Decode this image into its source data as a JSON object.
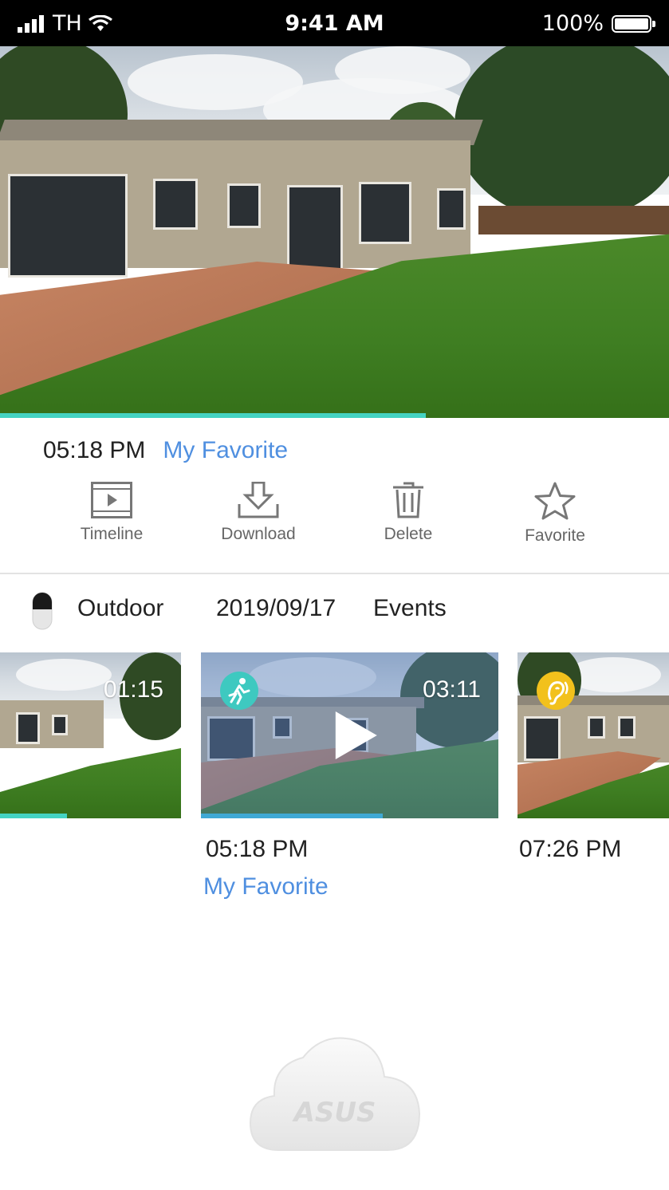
{
  "status_bar": {
    "carrier": "TH",
    "time": "9:41 AM",
    "battery": "100%"
  },
  "player": {
    "progress": 0.64,
    "time": "05:18 PM",
    "label": "My Favorite"
  },
  "actions": [
    {
      "label": "Timeline",
      "icon": "film-icon"
    },
    {
      "label": "Download",
      "icon": "download-icon"
    },
    {
      "label": "Delete",
      "icon": "trash-icon"
    },
    {
      "label": "Favorite",
      "icon": "star-icon"
    }
  ],
  "camera": {
    "name": "Outdoor",
    "date": "2019/09/17",
    "events_label": "Events"
  },
  "clips": [
    {
      "duration": "01:15",
      "progress": 0.37
    },
    {
      "duration": "03:11",
      "time": "05:18 PM",
      "label": "My Favorite",
      "event": "motion-icon",
      "progress": 0.61
    },
    {
      "time": "07:26 PM",
      "event": "sound-icon"
    }
  ],
  "colors": {
    "accent_teal": "#44d3c2",
    "link_blue": "#4f8fe0",
    "motion_badge": "#3ec9c0",
    "sound_badge": "#f2c11c"
  },
  "logo": "ASUS"
}
